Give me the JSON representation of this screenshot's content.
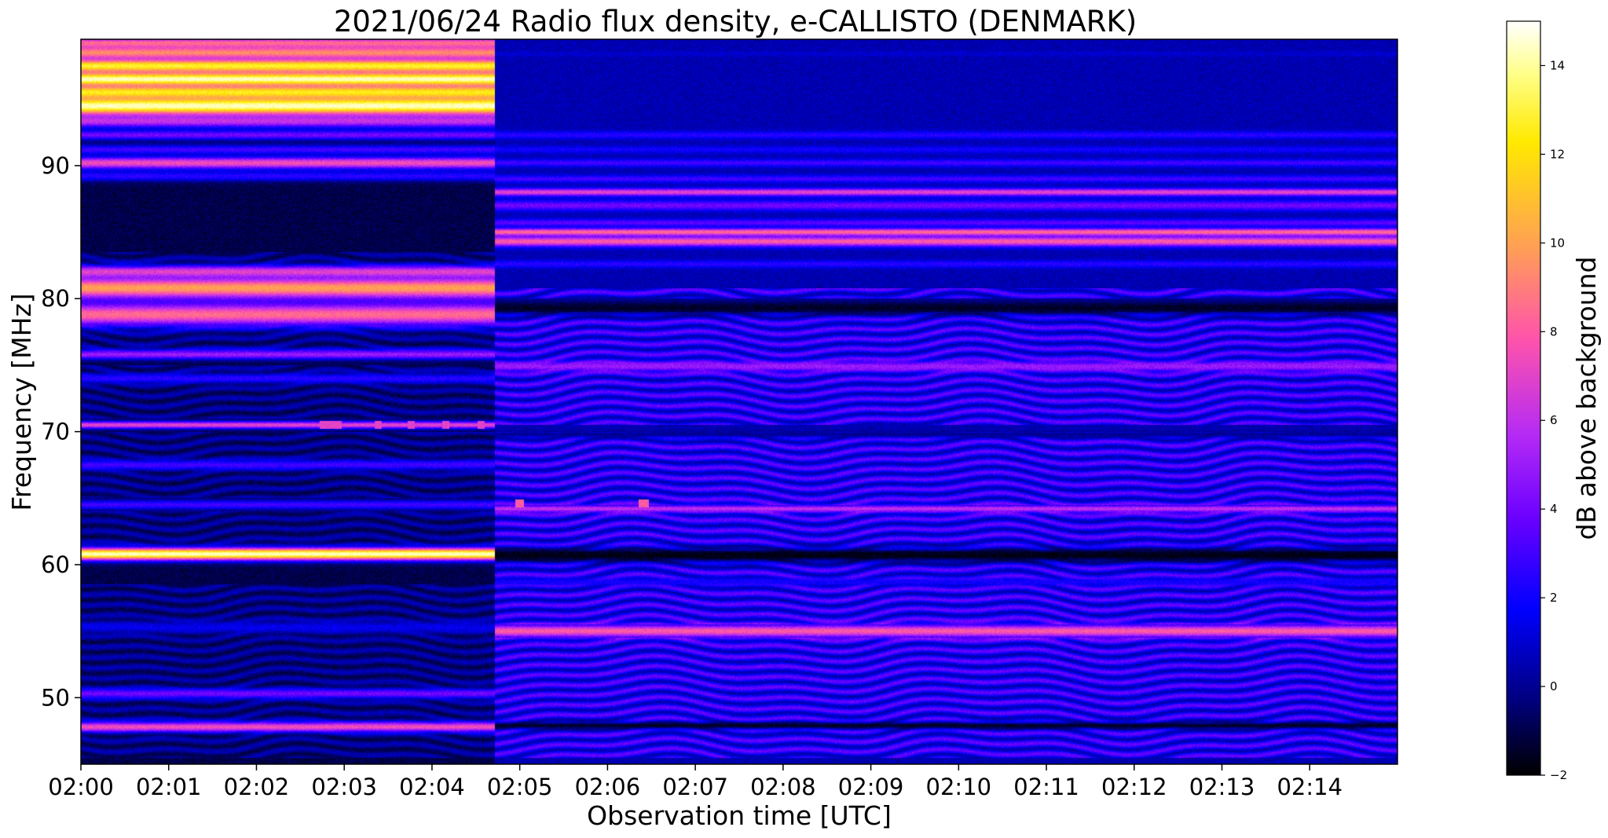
{
  "chart_data": {
    "type": "heatmap",
    "title": "2021/06/24  Radio flux density, e-CALLISTO (DENMARK)",
    "xlabel": "Observation time [UTC]",
    "ylabel": "Frequency [MHz]",
    "colorbar_label": "dB above background",
    "colormap": "gnuplot2",
    "colormap_stops": [
      "#000000",
      "#00007f",
      "#0000ff",
      "#6a00ff",
      "#b42af5",
      "#ff54aa",
      "#ff9f55",
      "#ffe900",
      "#ffff88",
      "#ffffff"
    ],
    "x_unit": "minutes after 02:00 UTC",
    "xlim": [
      0,
      15
    ],
    "ylim": [
      45,
      99.5
    ],
    "clim": [
      -2,
      15
    ],
    "x_ticks": [
      {
        "label": "02:00",
        "value": 0
      },
      {
        "label": "02:01",
        "value": 1
      },
      {
        "label": "02:02",
        "value": 2
      },
      {
        "label": "02:03",
        "value": 3
      },
      {
        "label": "02:04",
        "value": 4
      },
      {
        "label": "02:05",
        "value": 5
      },
      {
        "label": "02:06",
        "value": 6
      },
      {
        "label": "02:07",
        "value": 7
      },
      {
        "label": "02:08",
        "value": 8
      },
      {
        "label": "02:09",
        "value": 9
      },
      {
        "label": "02:10",
        "value": 10
      },
      {
        "label": "02:11",
        "value": 11
      },
      {
        "label": "02:12",
        "value": 12
      },
      {
        "label": "02:13",
        "value": 13
      },
      {
        "label": "02:14",
        "value": 14
      }
    ],
    "y_ticks": [
      50,
      60,
      70,
      80,
      90
    ],
    "colorbar_ticks": [
      -2,
      0,
      2,
      4,
      6,
      8,
      10,
      12,
      14
    ],
    "segment_break_minutes": 4.72,
    "segments": [
      {
        "start": 0,
        "end": 4.72,
        "background_db": -1.0,
        "wave_db": 1.0,
        "wave_bands": [
          [
            45.5,
            58.5
          ],
          [
            61.5,
            64
          ],
          [
            65,
            70
          ],
          [
            71,
            75
          ],
          [
            76,
            78
          ],
          [
            82,
            83.5
          ]
        ],
        "lines": [
          {
            "freq": 47.8,
            "db": 7.5,
            "width": 0.4
          },
          {
            "freq": 50.3,
            "db": 4.0,
            "width": 0.4
          },
          {
            "freq": 55.3,
            "db": 1.5,
            "width": 0.5
          },
          {
            "freq": 60.8,
            "db": 14.5,
            "width": 0.5
          },
          {
            "freq": 64.5,
            "db": 3.0,
            "width": 0.4
          },
          {
            "freq": 67.5,
            "db": 3.0,
            "width": 0.4
          },
          {
            "freq": 70.5,
            "db": 7.0,
            "width": 0.3
          },
          {
            "freq": 74.0,
            "db": 2.5,
            "width": 0.4
          },
          {
            "freq": 75.8,
            "db": 5.0,
            "width": 0.4
          },
          {
            "freq": 78.8,
            "db": 8.5,
            "width": 0.9
          },
          {
            "freq": 80.8,
            "db": 10.0,
            "width": 0.9
          },
          {
            "freq": 82.0,
            "db": 7.0,
            "width": 0.5
          },
          {
            "freq": 89.2,
            "db": 2.5,
            "width": 0.4
          },
          {
            "freq": 90.2,
            "db": 7.5,
            "width": 0.5
          },
          {
            "freq": 91.2,
            "db": 3.0,
            "width": 0.4
          },
          {
            "freq": 92.3,
            "db": 4.0,
            "width": 0.4
          },
          {
            "freq": 93.3,
            "db": 5.5,
            "width": 0.5
          },
          {
            "freq": 94.5,
            "db": 14.5,
            "width": 0.8
          },
          {
            "freq": 95.5,
            "db": 12.5,
            "width": 0.6
          },
          {
            "freq": 96.5,
            "db": 14.5,
            "width": 0.6
          },
          {
            "freq": 97.5,
            "db": 13.0,
            "width": 0.6
          },
          {
            "freq": 98.5,
            "db": 9.5,
            "width": 0.6
          },
          {
            "freq": 99.2,
            "db": 8.5,
            "width": 0.5
          }
        ]
      },
      {
        "start": 4.72,
        "end": 15,
        "background_db": 0.5,
        "wave_db": 2.0,
        "wave_bands": [
          [
            45.5,
            54.5
          ],
          [
            55.5,
            60.5
          ],
          [
            61,
            64
          ],
          [
            64.5,
            70
          ],
          [
            70.5,
            79
          ],
          [
            80,
            80.8
          ]
        ],
        "lines": [
          {
            "freq": 47.9,
            "db": -1.5,
            "width": 0.3
          },
          {
            "freq": 55.0,
            "db": 8.0,
            "width": 0.5
          },
          {
            "freq": 58.7,
            "db": 2.0,
            "width": 0.3
          },
          {
            "freq": 60.7,
            "db": -1.8,
            "width": 0.6
          },
          {
            "freq": 64.2,
            "db": 6.0,
            "width": 0.3
          },
          {
            "freq": 69.8,
            "db": 0.0,
            "width": 0.3
          },
          {
            "freq": 74.9,
            "db": 5.0,
            "width": 0.4
          },
          {
            "freq": 79.3,
            "db": -1.5,
            "width": 0.6
          },
          {
            "freq": 82.6,
            "db": 2.5,
            "width": 0.3
          },
          {
            "freq": 84.3,
            "db": 8.0,
            "width": 0.4
          },
          {
            "freq": 85.0,
            "db": 8.5,
            "width": 0.3
          },
          {
            "freq": 85.7,
            "db": 3.5,
            "width": 0.3
          },
          {
            "freq": 87.0,
            "db": 4.0,
            "width": 0.4
          },
          {
            "freq": 88.0,
            "db": 7.0,
            "width": 0.3
          },
          {
            "freq": 89.0,
            "db": 3.0,
            "width": 0.3
          },
          {
            "freq": 90.2,
            "db": 3.0,
            "width": 0.3
          },
          {
            "freq": 91.2,
            "db": 2.0,
            "width": 0.3
          },
          {
            "freq": 92.3,
            "db": 2.5,
            "width": 0.3
          },
          {
            "freq": 98.4,
            "db": 1.0,
            "width": 0.2
          }
        ]
      }
    ],
    "blips": [
      {
        "start": 2.72,
        "end": 2.97,
        "freq": 70.5,
        "db": 7.0
      },
      {
        "start": 3.35,
        "end": 3.43,
        "freq": 70.5,
        "db": 7.0
      },
      {
        "start": 3.72,
        "end": 3.8,
        "freq": 70.5,
        "db": 7.0
      },
      {
        "start": 4.12,
        "end": 4.2,
        "freq": 70.5,
        "db": 7.0
      },
      {
        "start": 4.52,
        "end": 4.6,
        "freq": 70.5,
        "db": 7.0
      },
      {
        "start": 4.95,
        "end": 5.05,
        "freq": 64.6,
        "db": 8.0
      },
      {
        "start": 6.35,
        "end": 6.47,
        "freq": 64.6,
        "db": 8.0
      }
    ]
  }
}
